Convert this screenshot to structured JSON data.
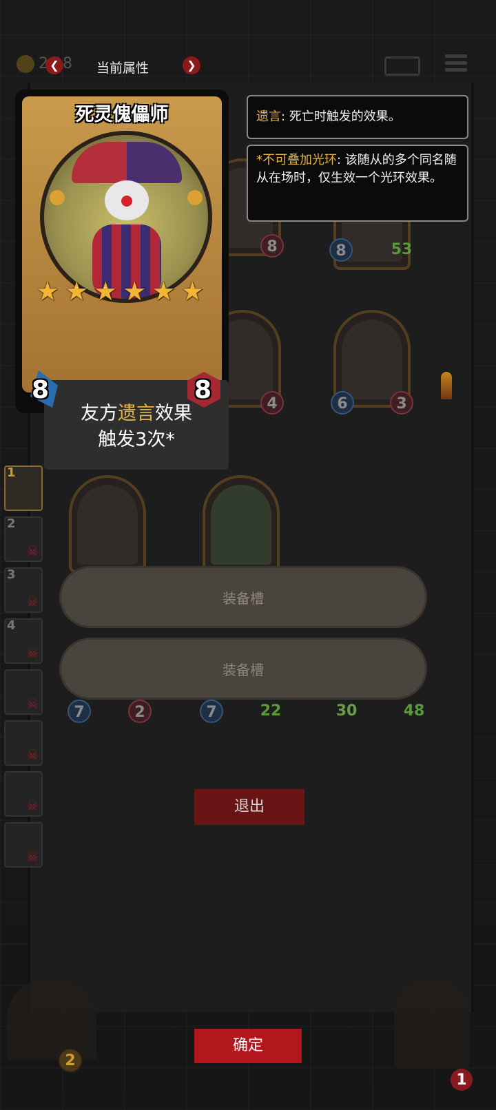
{
  "topbar": {
    "gold_amount": "2 18",
    "title": "当前属性",
    "prev_icon": "chevron-left",
    "next_icon": "chevron-right"
  },
  "card": {
    "name": "死灵傀儡师",
    "stars": 6,
    "desc_prefix": "友方",
    "desc_keyword": "遗言",
    "desc_suffix": "效果",
    "desc_line2": "触发3次*",
    "attack": "8",
    "health": "8"
  },
  "tooltips": [
    {
      "keyword": "遗言",
      "text": ": 死亡时触发的效果。"
    },
    {
      "keyword": "*不可叠加光环",
      "text": ": 该随从的多个同名随从在场时，仅生效一个光环效果。"
    }
  ],
  "board": {
    "row1": [
      {
        "atk": "8",
        "hp": "8"
      },
      {
        "atk": "8",
        "hp": "53"
      }
    ],
    "row2": [
      {
        "atk": "",
        "hp": "4"
      },
      {
        "atk": "6",
        "hp": "3"
      }
    ],
    "row3": [
      {
        "atk": "7",
        "hp": "2"
      },
      {
        "atk": "7",
        "hp": "22"
      },
      {
        "atk": "30",
        "hp": "48"
      }
    ]
  },
  "roster": [
    "1",
    "2",
    "3",
    "4",
    "",
    "",
    "",
    ""
  ],
  "equipment": {
    "slot1": "装备槽",
    "slot2": "装备槽"
  },
  "buttons": {
    "exit": "退出",
    "confirm": "确定"
  },
  "bottom": {
    "left_badge": "2",
    "right_badge": "1"
  },
  "colors": {
    "accent_gold": "#e3b445",
    "button_red": "#b3171e",
    "attack_blue": "#2c6db0",
    "health_red": "#a52833"
  }
}
